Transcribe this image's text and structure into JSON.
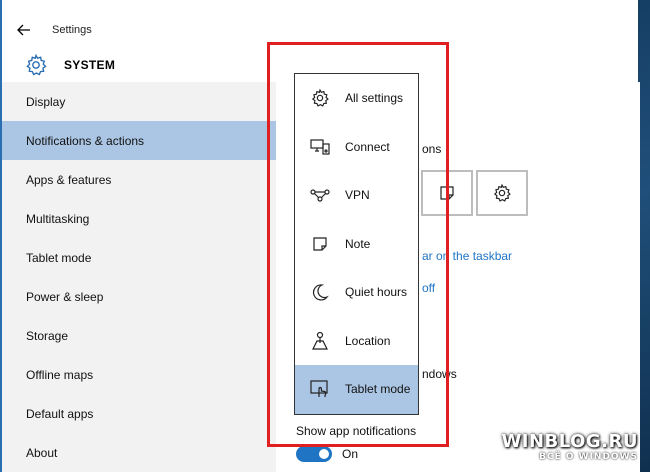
{
  "window": {
    "title": "Settings",
    "back_icon": "arrow-left-icon"
  },
  "header": {
    "icon": "gear-icon",
    "title": "SYSTEM"
  },
  "sidebar": {
    "selected_index": 1,
    "items": [
      {
        "label": "Display"
      },
      {
        "label": "Notifications & actions"
      },
      {
        "label": "Apps & features"
      },
      {
        "label": "Multitasking"
      },
      {
        "label": "Tablet mode"
      },
      {
        "label": "Power & sleep"
      },
      {
        "label": "Storage"
      },
      {
        "label": "Offline maps"
      },
      {
        "label": "Default apps"
      },
      {
        "label": "About"
      }
    ]
  },
  "content": {
    "fragment_1": "ons",
    "fragment_2": "ar on the taskbar",
    "fragment_3": "off",
    "fragment_4": "ndows",
    "show_notifications_label": "Show app notifications",
    "toggle_value": "On"
  },
  "popup": {
    "selected_index": 6,
    "items": [
      {
        "label": "All settings",
        "icon": "gear-icon"
      },
      {
        "label": "Connect",
        "icon": "connect-icon"
      },
      {
        "label": "VPN",
        "icon": "vpn-icon"
      },
      {
        "label": "Note",
        "icon": "note-icon"
      },
      {
        "label": "Quiet hours",
        "icon": "moon-icon"
      },
      {
        "label": "Location",
        "icon": "location-icon"
      },
      {
        "label": "Tablet mode",
        "icon": "tablet-mode-icon"
      }
    ]
  },
  "watermark": {
    "main": "WINBLOG.RU",
    "sub": "ВСЁ О WINDOWS"
  },
  "colors": {
    "accent": "#1f74c4",
    "selected_bg": "#abc6e4",
    "highlight_border": "#e02020"
  }
}
